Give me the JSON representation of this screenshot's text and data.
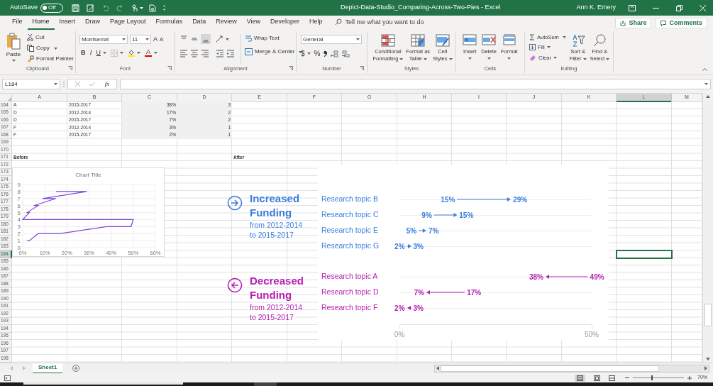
{
  "title_bar": {
    "autosave_label": "AutoSave",
    "autosave_on": false,
    "autosave_state": "Off",
    "document_title": "Depict-Data-Studio_Comparing-Across-Two-Pies - Excel",
    "user": "Ann K. Emery"
  },
  "menu_tabs": [
    {
      "label": "File",
      "selected": false
    },
    {
      "label": "Home",
      "selected": true
    },
    {
      "label": "Insert",
      "selected": false
    },
    {
      "label": "Draw",
      "selected": false
    },
    {
      "label": "Page Layout",
      "selected": false
    },
    {
      "label": "Formulas",
      "selected": false
    },
    {
      "label": "Data",
      "selected": false
    },
    {
      "label": "Review",
      "selected": false
    },
    {
      "label": "View",
      "selected": false
    },
    {
      "label": "Developer",
      "selected": false
    },
    {
      "label": "Help",
      "selected": false
    }
  ],
  "tell_me": {
    "placeholder": "Tell me what you want to do"
  },
  "share_button": "Share",
  "comments_button": "Comments",
  "ribbon": {
    "clipboard": {
      "label": "Clipboard",
      "paste": "Paste",
      "cut": "Cut",
      "copy": "Copy",
      "format_painter": "Format Painter"
    },
    "font": {
      "label": "Font",
      "font_name": "Montserrat",
      "font_size": "11",
      "grow": "A",
      "shrink": "A",
      "bold": "B",
      "italic": "I",
      "underline": "U",
      "font_color": "A"
    },
    "alignment": {
      "label": "Alignment",
      "wrap_text": "Wrap Text",
      "merge_center": "Merge & Center"
    },
    "number": {
      "label": "Number",
      "format": "General",
      "currency": "$",
      "percent": "%"
    },
    "styles": {
      "label": "Styles",
      "buttons": [
        {
          "lines": [
            "Conditional",
            "Formatting"
          ]
        },
        {
          "lines": [
            "Format as",
            "Table"
          ]
        },
        {
          "lines": [
            "Cell",
            "Styles"
          ]
        }
      ]
    },
    "cells": {
      "label": "Cells",
      "buttons": [
        "Insert",
        "Delete",
        "Format"
      ]
    },
    "editing": {
      "label": "Editing",
      "autosum": "AutoSum",
      "fill": "Fill",
      "clear": "Clear",
      "sort_filter": [
        "Sort &",
        "Filter"
      ],
      "find_select": [
        "Find &",
        "Select"
      ]
    }
  },
  "formula_bar": {
    "name_box": "L184",
    "fx": "fx"
  },
  "columns": [
    {
      "label": "A",
      "selected": false
    },
    {
      "label": "B",
      "selected": false
    },
    {
      "label": "C",
      "selected": false
    },
    {
      "label": "D",
      "selected": false
    },
    {
      "label": "E",
      "selected": false
    },
    {
      "label": "F",
      "selected": false
    },
    {
      "label": "G",
      "selected": false
    },
    {
      "label": "H",
      "selected": false
    },
    {
      "label": "I",
      "selected": false
    },
    {
      "label": "J",
      "selected": false
    },
    {
      "label": "K",
      "selected": false
    },
    {
      "label": "L",
      "selected": true
    },
    {
      "label": "M",
      "selected": false
    }
  ],
  "rows": [
    {
      "number": "164",
      "selected": false,
      "kind": "data",
      "cells": {
        "A": "A",
        "B": "2015-2017",
        "C": "38%",
        "D": "3"
      }
    },
    {
      "number": "165",
      "selected": false,
      "kind": "data",
      "cells": {
        "A": "D",
        "B": "2012-2014",
        "C": "17%",
        "D": "2"
      }
    },
    {
      "number": "166",
      "selected": false,
      "kind": "data",
      "cells": {
        "A": "D",
        "B": "2015-2017",
        "C": "7%",
        "D": "2"
      }
    },
    {
      "number": "167",
      "selected": false,
      "kind": "data",
      "cells": {
        "A": "F",
        "B": "2012-2014",
        "C": "3%",
        "D": "1"
      }
    },
    {
      "number": "168",
      "selected": false,
      "kind": "data",
      "cells": {
        "A": "F",
        "B": "2015-2017",
        "C": "2%",
        "D": "1"
      }
    },
    {
      "number": "169",
      "selected": false,
      "kind": "blank"
    },
    {
      "number": "170",
      "selected": false,
      "kind": "blank"
    },
    {
      "number": "171",
      "selected": false,
      "kind": "heading",
      "cells": {
        "A": "Before",
        "E": "After"
      }
    },
    {
      "number": "172",
      "selected": false,
      "kind": "blank"
    },
    {
      "number": "173",
      "selected": false,
      "kind": "blank"
    },
    {
      "number": "174",
      "selected": false,
      "kind": "blank"
    },
    {
      "number": "175",
      "selected": false,
      "kind": "blank"
    },
    {
      "number": "176",
      "selected": false,
      "kind": "blank"
    },
    {
      "number": "177",
      "selected": false,
      "kind": "blank"
    },
    {
      "number": "178",
      "selected": false,
      "kind": "blank"
    },
    {
      "number": "179",
      "selected": false,
      "kind": "blank"
    },
    {
      "number": "180",
      "selected": false,
      "kind": "blank"
    },
    {
      "number": "181",
      "selected": false,
      "kind": "blank"
    },
    {
      "number": "182",
      "selected": false,
      "kind": "blank"
    },
    {
      "number": "183",
      "selected": false,
      "kind": "blank"
    },
    {
      "number": "184",
      "selected": true,
      "kind": "blank"
    },
    {
      "number": "185",
      "selected": false,
      "kind": "blank"
    },
    {
      "number": "186",
      "selected": false,
      "kind": "blank"
    },
    {
      "number": "187",
      "selected": false,
      "kind": "blank"
    },
    {
      "number": "188",
      "selected": false,
      "kind": "blank"
    },
    {
      "number": "189",
      "selected": false,
      "kind": "blank"
    },
    {
      "number": "190",
      "selected": false,
      "kind": "blank"
    },
    {
      "number": "191",
      "selected": false,
      "kind": "blank"
    },
    {
      "number": "192",
      "selected": false,
      "kind": "blank"
    },
    {
      "number": "193",
      "selected": false,
      "kind": "blank"
    },
    {
      "number": "194",
      "selected": false,
      "kind": "blank"
    },
    {
      "number": "195",
      "selected": false,
      "kind": "blank"
    },
    {
      "number": "196",
      "selected": false,
      "kind": "blank"
    },
    {
      "number": "197",
      "selected": false,
      "kind": "blank"
    },
    {
      "number": "198",
      "selected": false,
      "kind": "blank"
    }
  ],
  "before_chart": {
    "chart_data": {
      "type": "line",
      "grid": true,
      "title": "Chart Title",
      "x": [
        15,
        29,
        9,
        15,
        5,
        7,
        2,
        3,
        0,
        50,
        49,
        38,
        17,
        7,
        3,
        2
      ],
      "series": [
        {
          "color": "#7b45dc",
          "values": [
            8,
            8,
            7,
            7,
            6,
            6,
            5,
            5,
            4,
            4,
            3,
            3,
            2,
            2,
            1,
            1
          ]
        }
      ],
      "xlim": [
        0,
        60
      ],
      "ylim": [
        0,
        9
      ],
      "xticks": [
        {
          "value": 0,
          "label": "0%"
        },
        {
          "value": 10,
          "label": "10%"
        },
        {
          "value": 20,
          "label": "20%"
        },
        {
          "value": 30,
          "label": "30%"
        },
        {
          "value": 40,
          "label": "40%"
        },
        {
          "value": 50,
          "label": "50%"
        },
        {
          "value": 60,
          "label": "60%"
        }
      ],
      "yticks": [
        {
          "value": 0,
          "label": "0"
        },
        {
          "value": 1,
          "label": "1"
        },
        {
          "value": 2,
          "label": "2"
        },
        {
          "value": 3,
          "label": "3"
        },
        {
          "value": 4,
          "label": "4"
        },
        {
          "value": 5,
          "label": "5"
        },
        {
          "value": 6,
          "label": "6"
        },
        {
          "value": 7,
          "label": "7"
        },
        {
          "value": 8,
          "label": "8"
        },
        {
          "value": 9,
          "label": "9"
        }
      ]
    }
  },
  "infographic": {
    "groups": [
      {
        "kind": "increase",
        "color": "#3b7ddd",
        "title": "Increased Funding",
        "subtitle": "from 2012-2014 to 2015-2017",
        "rows": [
          {
            "topic": "Research topic B",
            "from": "15%",
            "to": "29%"
          },
          {
            "topic": "Research topic C",
            "from": "9%",
            "to": "15%"
          },
          {
            "topic": "Research topic E",
            "from": "5%",
            "to": "7%"
          },
          {
            "topic": "Research topic G",
            "from": "2%",
            "to": "3%"
          }
        ]
      },
      {
        "kind": "decrease",
        "color": "#b620b4",
        "title": "Decreased Funding",
        "subtitle": "from 2012-2014 to 2015-2017",
        "rows": [
          {
            "topic": "Research topic A",
            "from": "49%",
            "to": "38%"
          },
          {
            "topic": "Research topic D",
            "from": "17%",
            "to": "7%"
          },
          {
            "topic": "Research topic F",
            "from": "3%",
            "to": "2%"
          }
        ]
      }
    ],
    "axis_labels": [
      "0%",
      "50%"
    ]
  },
  "sheet_tabs": [
    {
      "label": "Sheet1",
      "selected": true
    }
  ],
  "zoom": {
    "label": "70%",
    "level": 0.375
  }
}
